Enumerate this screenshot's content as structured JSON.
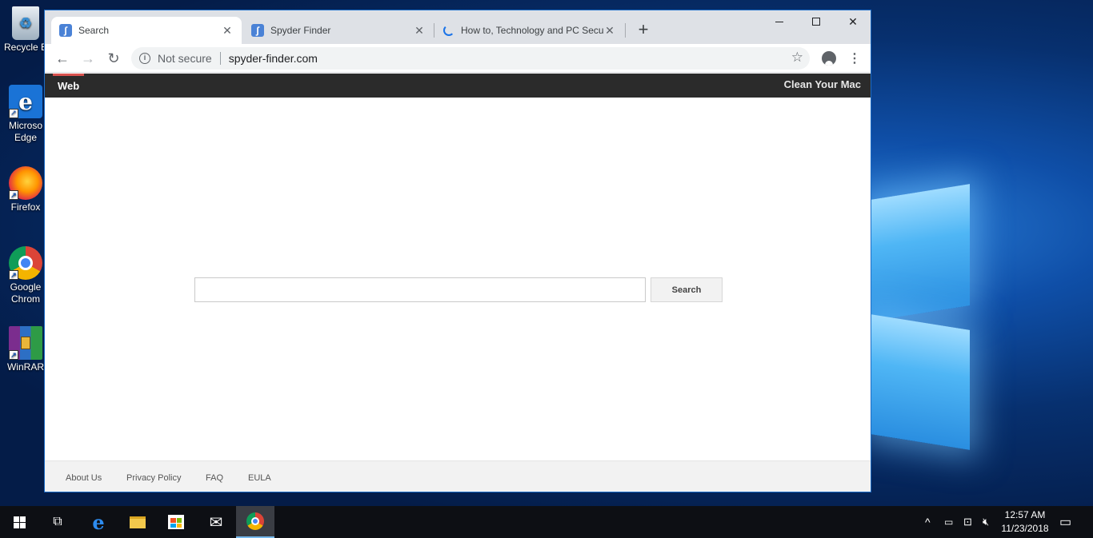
{
  "desktop": {
    "icons": [
      {
        "label": "Recycle B",
        "icon": "recycle-bin-icon"
      },
      {
        "label": "Microso\nEdge",
        "icon": "edge-icon"
      },
      {
        "label": "Firefox",
        "icon": "firefox-icon"
      },
      {
        "label": "Google\nChrom",
        "icon": "chrome-icon"
      },
      {
        "label": "WinRAR",
        "icon": "winrar-icon"
      }
    ]
  },
  "browser": {
    "tabs": [
      {
        "title": "Search",
        "close": "✕",
        "active": true,
        "favicon": "spyder-icon"
      },
      {
        "title": "Spyder Finder",
        "close": "✕",
        "active": false,
        "favicon": "spyder-icon"
      },
      {
        "title": "How to, Technology and PC Secu",
        "close": "✕",
        "active": false,
        "favicon": "loading-spinner-icon"
      }
    ],
    "new_tab": "+",
    "window_controls": {
      "close": "✕"
    },
    "address": {
      "security_label": "Not secure",
      "url": "spyder-finder.com"
    }
  },
  "page": {
    "nav": {
      "web": "Web",
      "clean_mac": "Clean Your Mac"
    },
    "search": {
      "placeholder": "",
      "button": "Search"
    },
    "footer": {
      "about": "About Us",
      "privacy": "Privacy Policy",
      "faq": "FAQ",
      "eula": "EULA"
    }
  },
  "taskbar": {
    "clock_time": "12:57 AM",
    "clock_date": "11/23/2018"
  },
  "colors": {
    "site_bar": "#2b2b2b",
    "site_bar_accent": "#d9534f",
    "chrome_frame": "#dee1e6",
    "taskbar": "#0d0f14"
  }
}
